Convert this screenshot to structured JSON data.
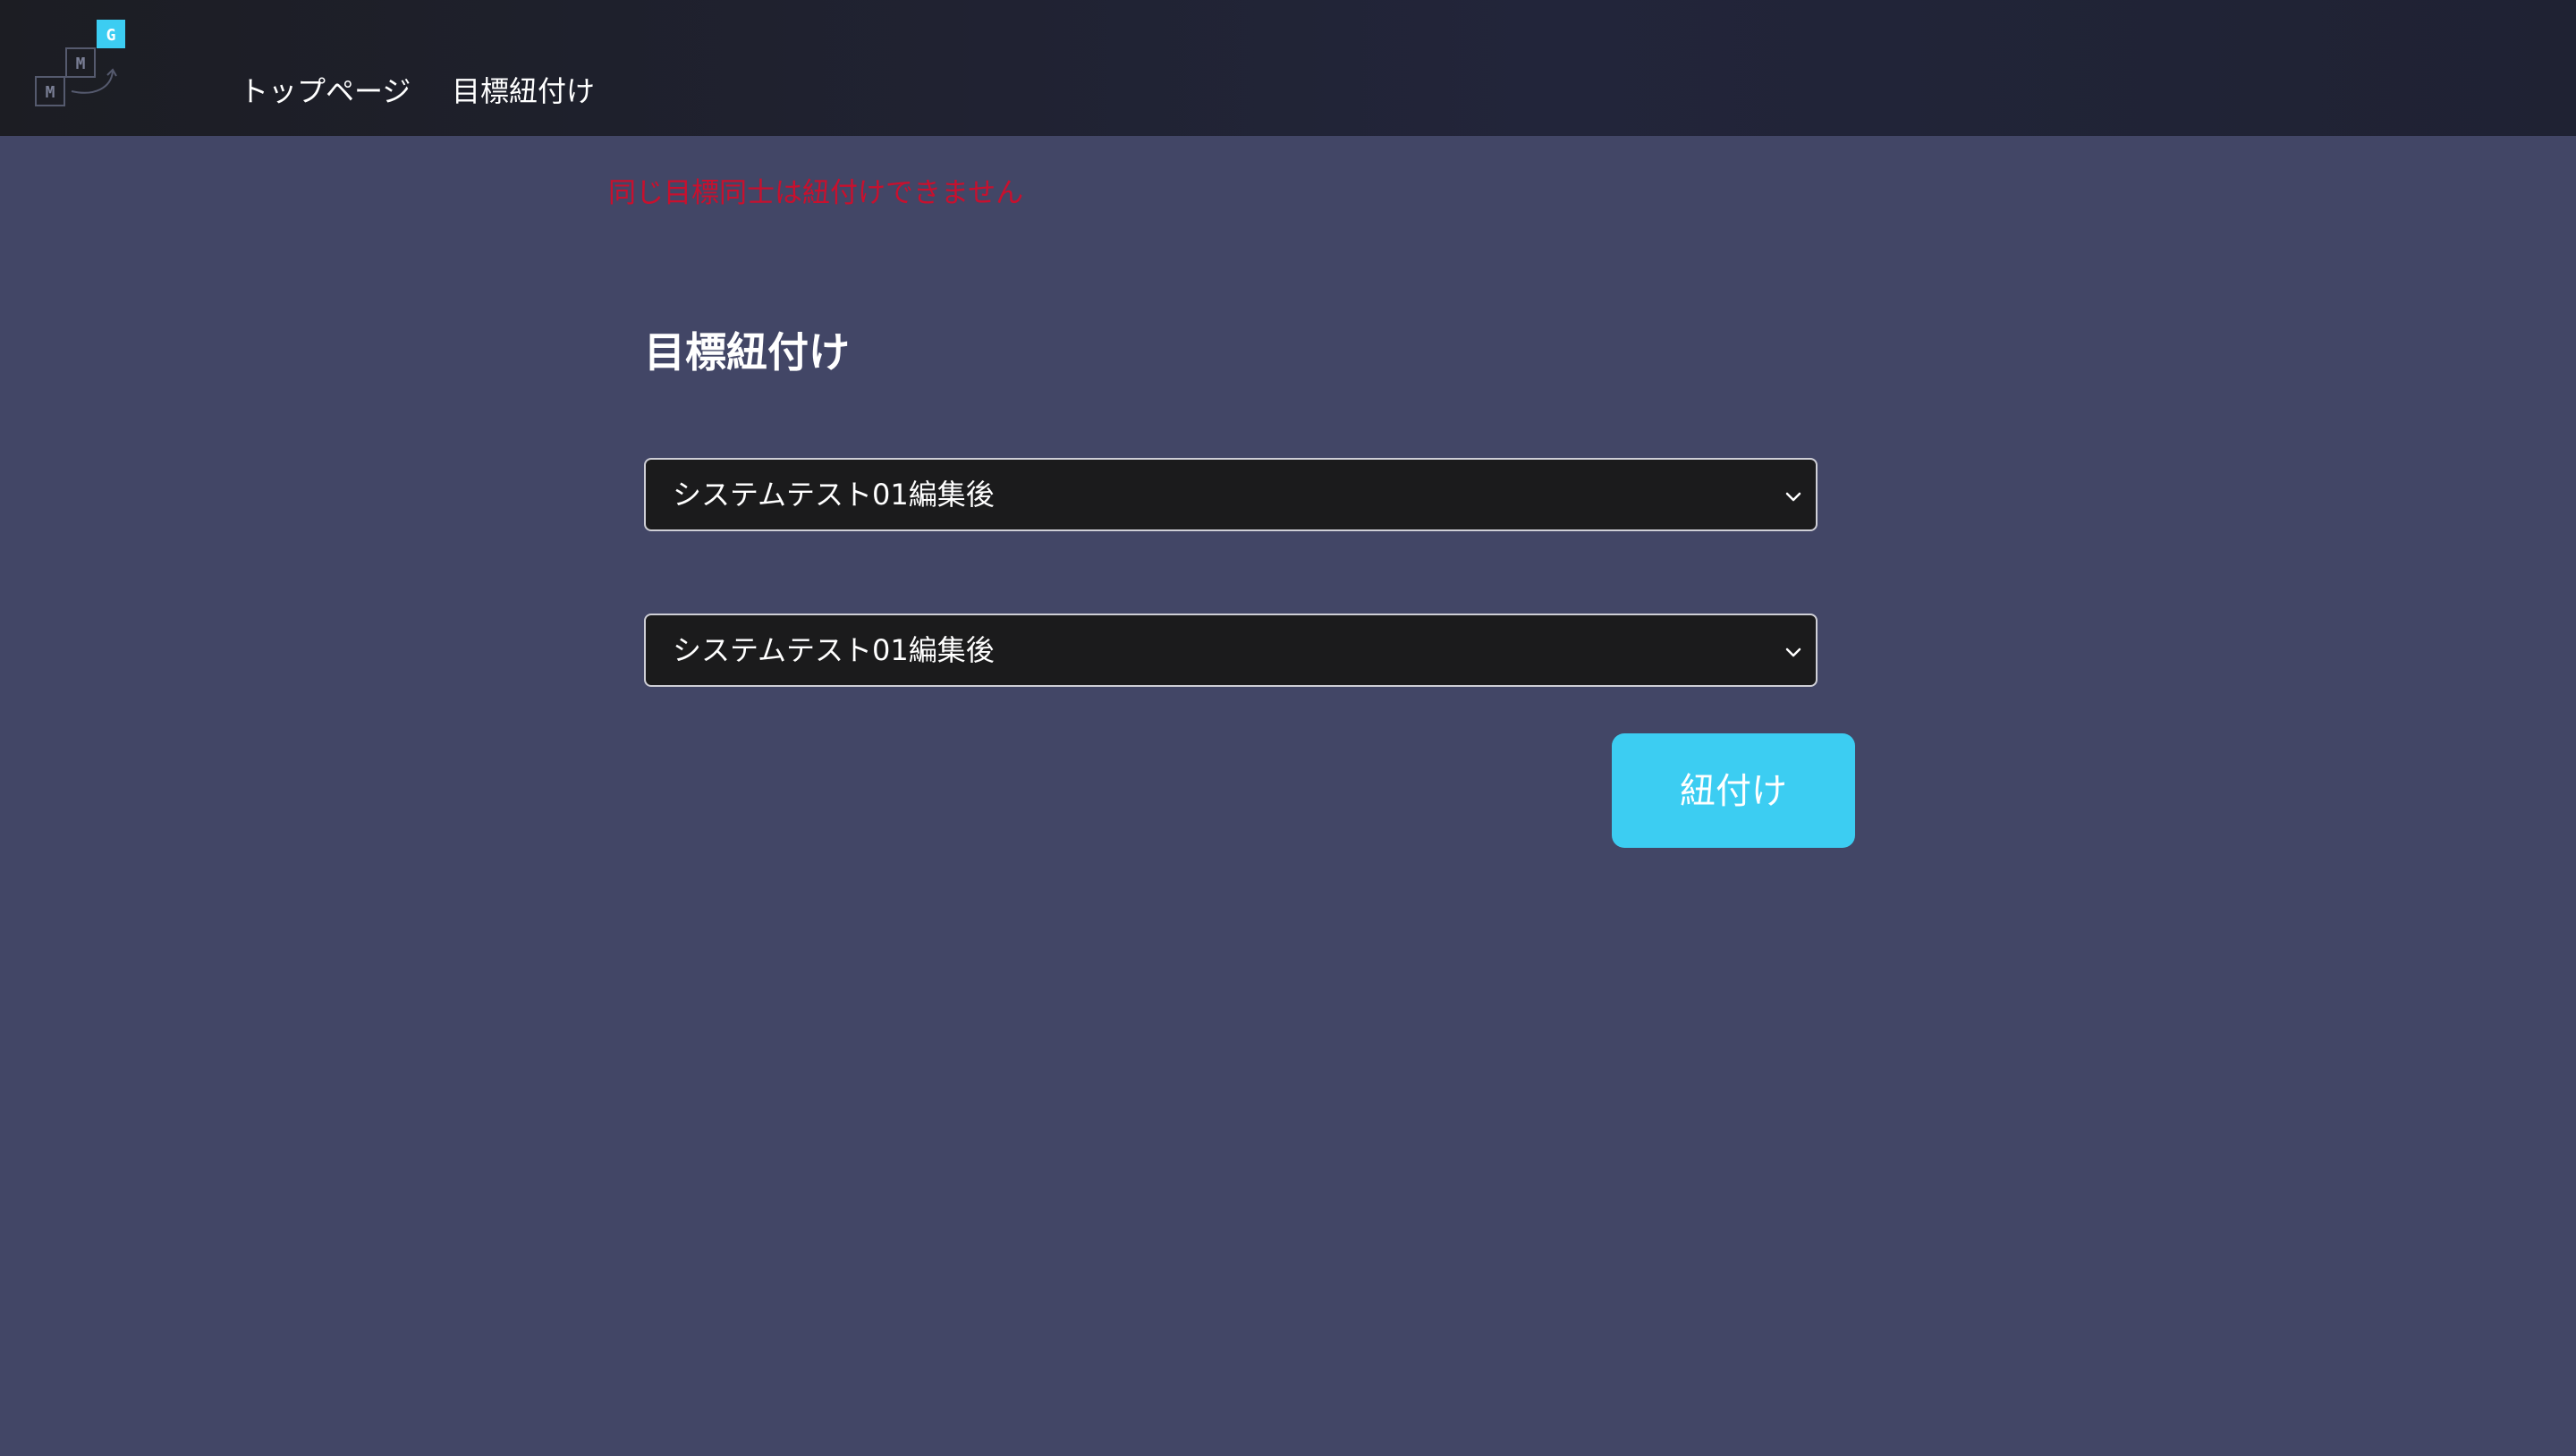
{
  "nav": {
    "logo_letters": [
      "M",
      "M",
      "G"
    ],
    "links": [
      "トップページ",
      "目標紐付け"
    ]
  },
  "error": "同じ目標同士は紐付けできません",
  "page": {
    "title": "目標紐付け",
    "select_1_value": "システムテスト01編集後",
    "select_2_value": "システムテスト01編集後",
    "submit_label": "紐付け"
  },
  "colors": {
    "background": "#424666",
    "navbar": "#1f2130",
    "accent": "#3ccdf2",
    "error": "#c8102e"
  },
  "icons": {
    "select_arrow": "chevron-down-icon",
    "logo": "logo-icon"
  }
}
